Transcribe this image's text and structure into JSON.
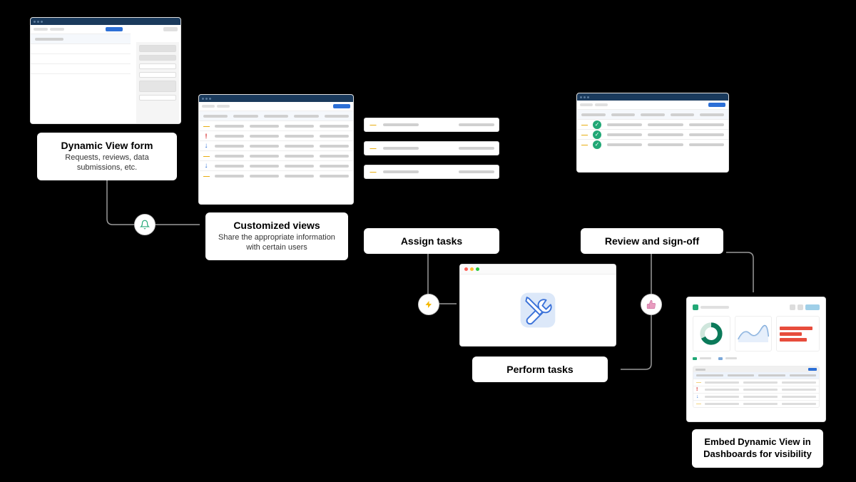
{
  "labels": {
    "form": {
      "title": "Dynamic View form",
      "sub": "Requests, reviews, data submissions, etc."
    },
    "views": {
      "title": "Customized views",
      "sub": "Share the appropriate information with certain users"
    },
    "assign": {
      "title": "Assign tasks"
    },
    "perform": {
      "title": "Perform tasks"
    },
    "review": {
      "title": "Review and sign-off"
    },
    "embed": {
      "title": "Embed Dynamic View in Dashboards for visibility"
    }
  },
  "icons": {
    "bell": "bell-icon",
    "bolt": "bolt-icon",
    "thumb": "thumb-icon",
    "tools": "tools-icon"
  }
}
